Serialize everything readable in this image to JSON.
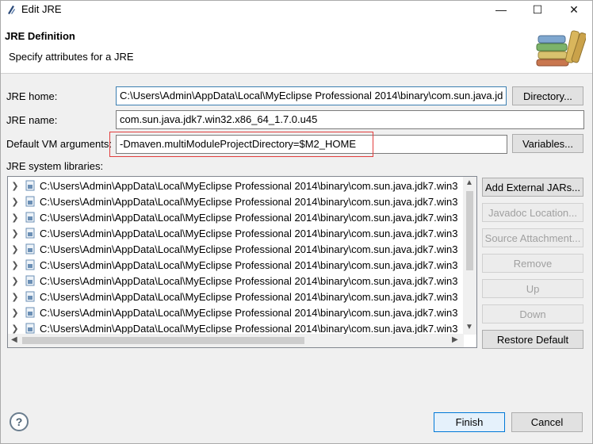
{
  "window": {
    "title": "Edit JRE",
    "minimize_glyph": "—",
    "maximize_glyph": "☐",
    "close_glyph": "✕"
  },
  "header": {
    "title": "JRE Definition",
    "subtitle": "Specify attributes for a JRE",
    "image_icon": "books-icon"
  },
  "form": {
    "jre_home_label": "JRE home:",
    "jre_home_value": "C:\\Users\\Admin\\AppData\\Local\\MyEclipse Professional 2014\\binary\\com.sun.java.jd",
    "directory_button": "Directory...",
    "jre_name_label": "JRE name:",
    "jre_name_value": "com.sun.java.jdk7.win32.x86_64_1.7.0.u45",
    "vm_args_label": "Default VM arguments:",
    "vm_args_value": "-Dmaven.multiModuleProjectDirectory=$M2_HOME",
    "variables_button": "Variables...",
    "libraries_label": "JRE system libraries:"
  },
  "libraries": [
    "C:\\Users\\Admin\\AppData\\Local\\MyEclipse Professional 2014\\binary\\com.sun.java.jdk7.win3",
    "C:\\Users\\Admin\\AppData\\Local\\MyEclipse Professional 2014\\binary\\com.sun.java.jdk7.win3",
    "C:\\Users\\Admin\\AppData\\Local\\MyEclipse Professional 2014\\binary\\com.sun.java.jdk7.win3",
    "C:\\Users\\Admin\\AppData\\Local\\MyEclipse Professional 2014\\binary\\com.sun.java.jdk7.win3",
    "C:\\Users\\Admin\\AppData\\Local\\MyEclipse Professional 2014\\binary\\com.sun.java.jdk7.win3",
    "C:\\Users\\Admin\\AppData\\Local\\MyEclipse Professional 2014\\binary\\com.sun.java.jdk7.win3",
    "C:\\Users\\Admin\\AppData\\Local\\MyEclipse Professional 2014\\binary\\com.sun.java.jdk7.win3",
    "C:\\Users\\Admin\\AppData\\Local\\MyEclipse Professional 2014\\binary\\com.sun.java.jdk7.win3",
    "C:\\Users\\Admin\\AppData\\Local\\MyEclipse Professional 2014\\binary\\com.sun.java.jdk7.win3",
    "C:\\Users\\Admin\\AppData\\Local\\MyEclipse Professional 2014\\binary\\com.sun.java.jdk7.win3"
  ],
  "side_buttons": {
    "add_external": "Add External JARs...",
    "javadoc": "Javadoc Location...",
    "source": "Source Attachment...",
    "remove": "Remove",
    "up": "Up",
    "down": "Down",
    "restore": "Restore Default"
  },
  "footer": {
    "help_glyph": "?",
    "finish": "Finish",
    "cancel": "Cancel"
  },
  "colors": {
    "highlight_box": "#e23d3d",
    "default_button_border": "#0078d7",
    "jar_icon": "#6b8fb5"
  }
}
